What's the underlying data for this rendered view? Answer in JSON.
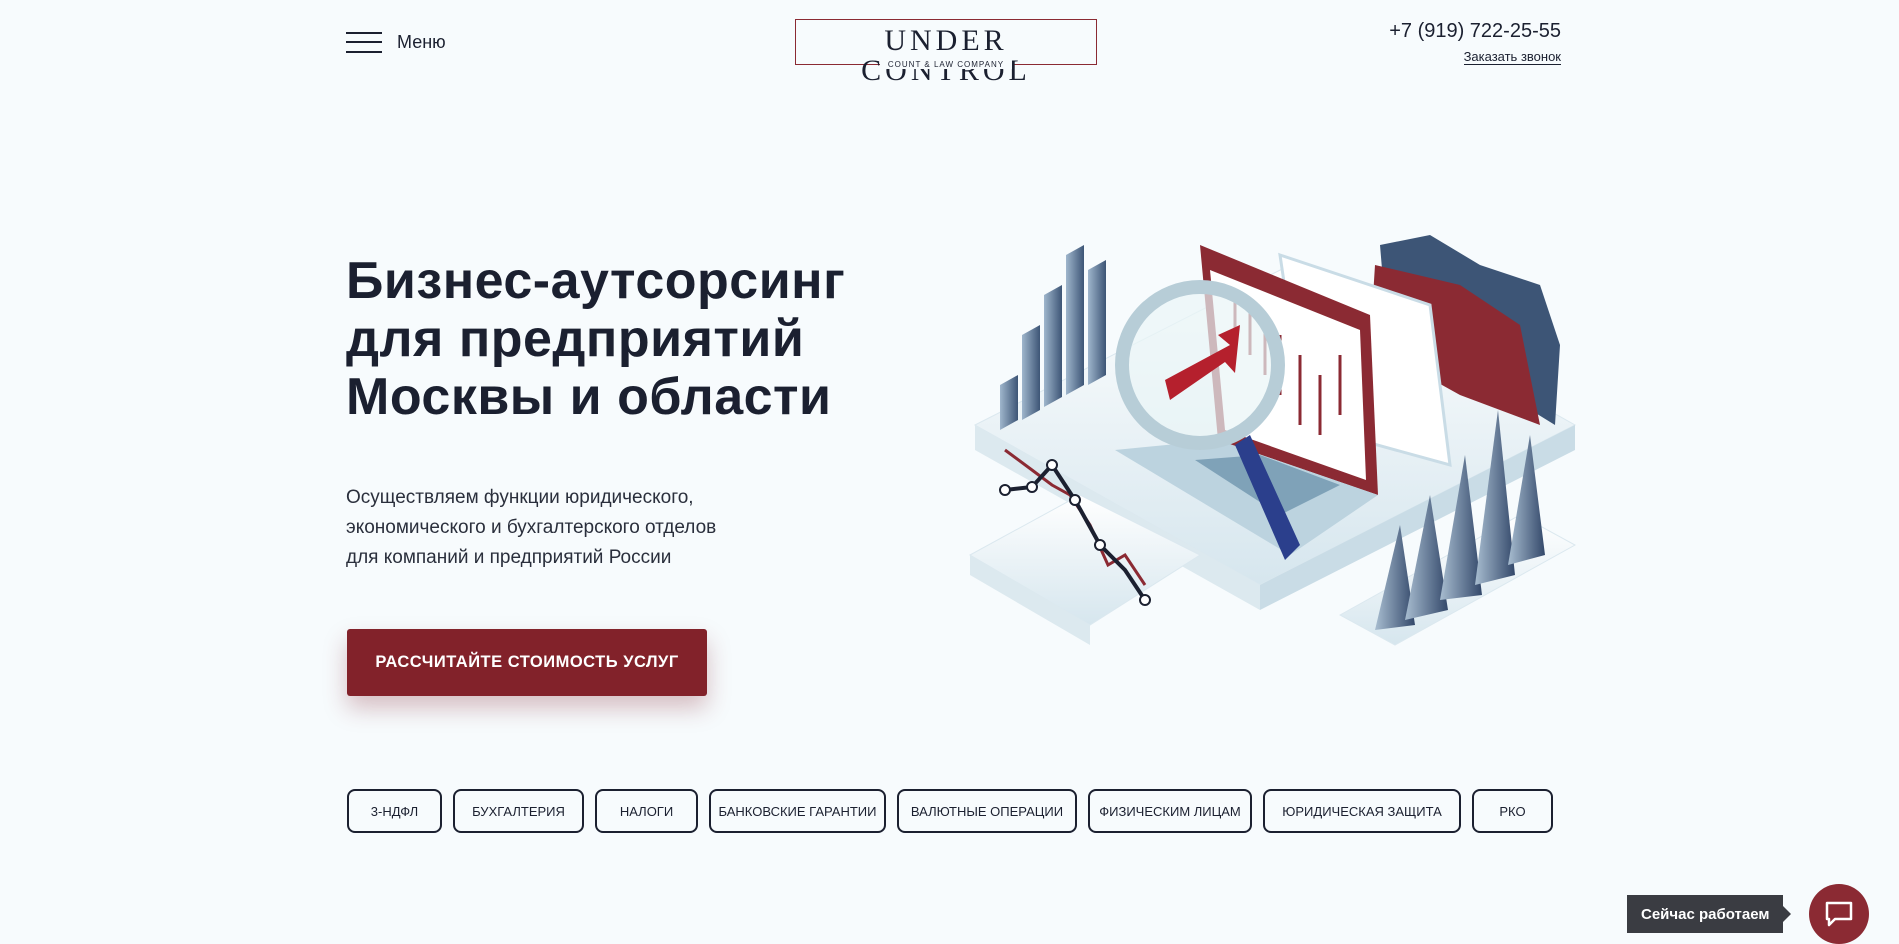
{
  "header": {
    "menu_label": "Меню",
    "logo_main": "UNDER CONTROL",
    "logo_sub": "COUNT & LAW COMPANY",
    "phone": "+7 (919) 722-25-55",
    "callback_label": "Заказать звонок"
  },
  "hero": {
    "title_lines": [
      "Бизнес-аутсорсинг",
      "для предприятий",
      "Москвы и области"
    ],
    "subtitle_lines": [
      "Осуществляем функции юридического,",
      "экономического и бухгалтерского отделов",
      "для компаний и предприятий России"
    ],
    "cta_label": "РАССЧИТАЙТЕ СТОИМОСТЬ УСЛУГ"
  },
  "tags": [
    "3-НДФЛ",
    "БУХГАЛТЕРИЯ",
    "НАЛОГИ",
    "БАНКОВСКИЕ ГАРАНТИИ",
    "ВАЛЮТНЫЕ ОПЕРАЦИИ",
    "ФИЗИЧЕСКИМ ЛИЦАМ",
    "ЮРИДИЧЕСКАЯ ЗАЩИТА",
    "РКО"
  ],
  "widget": {
    "status_label": "Сейчас работаем",
    "chat_icon": "chat-bubble-icon"
  },
  "colors": {
    "background": "#f7fbfd",
    "text": "#1b2030",
    "accent": "#82222a",
    "status_bg": "#3a3c42"
  }
}
